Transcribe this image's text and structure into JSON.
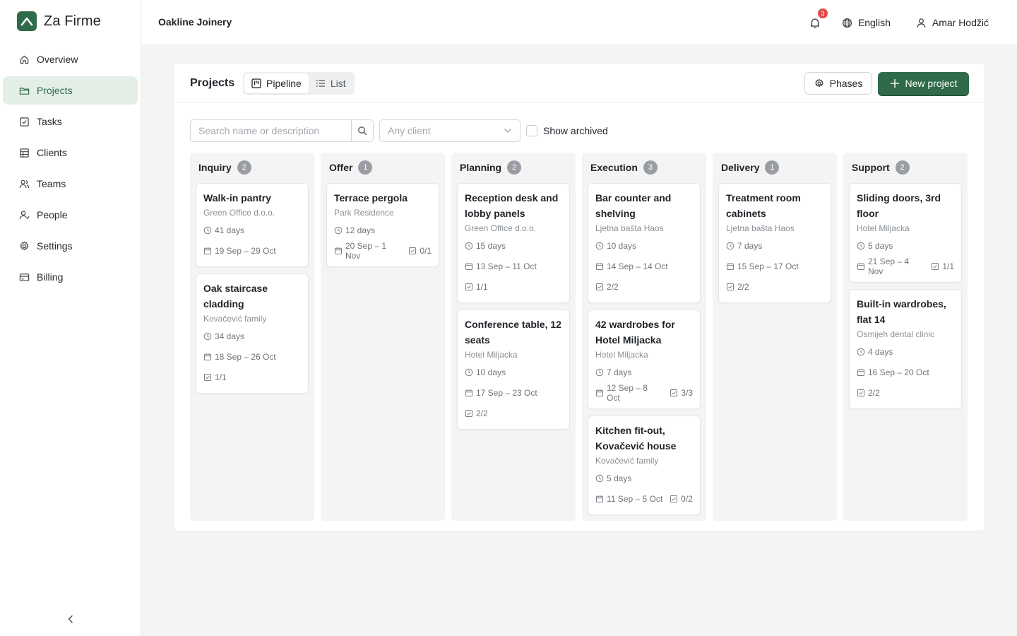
{
  "brand": {
    "name": "Za Firme",
    "logo_icon": "logo-mountain-icon",
    "accent": "#2f6b48"
  },
  "nav": [
    {
      "key": "overview",
      "label": "Overview",
      "icon": "home-icon",
      "active": false
    },
    {
      "key": "projects",
      "label": "Projects",
      "icon": "folder-icon",
      "active": true
    },
    {
      "key": "tasks",
      "label": "Tasks",
      "icon": "checkbox-icon",
      "active": false
    },
    {
      "key": "clients",
      "label": "Clients",
      "icon": "building-icon",
      "active": false
    },
    {
      "key": "teams",
      "label": "Teams",
      "icon": "team-icon",
      "active": false
    },
    {
      "key": "people",
      "label": "People",
      "icon": "people-icon",
      "active": false
    },
    {
      "key": "settings",
      "label": "Settings",
      "icon": "gear-icon",
      "active": false
    },
    {
      "key": "billing",
      "label": "Billing",
      "icon": "credit-card-icon",
      "active": false
    }
  ],
  "topbar": {
    "org_name": "Oakline Joinery",
    "notifications_count": "3",
    "language": "English",
    "user_name": "Amar Hodžić"
  },
  "projects": {
    "title": "Projects",
    "views": {
      "pipeline": "Pipeline",
      "list": "List",
      "active": "pipeline"
    },
    "phases_label": "Phases",
    "new_label": "New project",
    "search_placeholder": "Search name or description",
    "client_placeholder": "Any client",
    "show_archived_label": "Show archived"
  },
  "columns": [
    {
      "name": "Inquiry",
      "count": "2",
      "cards": [
        {
          "title": "Walk-in pantry",
          "client": "Green Office d.o.o.",
          "duration": "41 days",
          "dates": "19 Sep – 29 Oct",
          "tasks": ""
        },
        {
          "title": "Oak staircase cladding",
          "client": "Kovačević family",
          "duration": "34 days",
          "dates": "18 Sep – 26 Oct",
          "tasks": "1/1",
          "tasks_own_row": true
        }
      ]
    },
    {
      "name": "Offer",
      "count": "1",
      "cards": [
        {
          "title": "Terrace pergola",
          "client": "Park Residence",
          "duration": "12 days",
          "dates": "20 Sep – 1 Nov",
          "tasks": "0/1"
        }
      ]
    },
    {
      "name": "Planning",
      "count": "2",
      "cards": [
        {
          "title": "Reception desk and lobby panels",
          "client": "Green Office d.o.o.",
          "duration": "15 days",
          "dates": "13 Sep – 11 Oct",
          "tasks": "1/1",
          "tasks_own_row": true
        },
        {
          "title": "Conference table, 12 seats",
          "client": "Hotel Miljacka",
          "duration": "10 days",
          "dates": "17 Sep – 23 Oct",
          "tasks": "2/2",
          "tasks_own_row": true
        }
      ]
    },
    {
      "name": "Execution",
      "count": "3",
      "cards": [
        {
          "title": "Bar counter and shelving",
          "client": "Ljetna bašta Haos",
          "duration": "10 days",
          "dates": "14 Sep – 14 Oct",
          "tasks": "2/2",
          "tasks_own_row": true
        },
        {
          "title": "42 wardrobes for Hotel Miljacka",
          "client": "Hotel Miljacka",
          "duration": "7 days",
          "dates": "12 Sep – 8 Oct",
          "tasks": "3/3"
        },
        {
          "title": "Kitchen fit-out, Kovačević house",
          "client": "Kovačević family",
          "duration": "5 days",
          "dates": "11 Sep – 5 Oct",
          "tasks": "0/2"
        }
      ]
    },
    {
      "name": "Delivery",
      "count": "1",
      "cards": [
        {
          "title": "Treatment room cabinets",
          "client": "Ljetna bašta Haos",
          "duration": "7 days",
          "dates": "15 Sep – 17 Oct",
          "tasks": "2/2",
          "tasks_own_row": true
        }
      ]
    },
    {
      "name": "Support",
      "count": "2",
      "cards": [
        {
          "title": "Sliding doors, 3rd floor",
          "client": "Hotel Miljacka",
          "duration": "5 days",
          "dates": "21 Sep – 4 Nov",
          "tasks": "1/1"
        },
        {
          "title": "Built-in wardrobes, flat 14",
          "client": "Osmijeh dental clinic",
          "duration": "4 days",
          "dates": "16 Sep – 20 Oct",
          "tasks": "2/2",
          "tasks_own_row": true
        }
      ]
    }
  ]
}
